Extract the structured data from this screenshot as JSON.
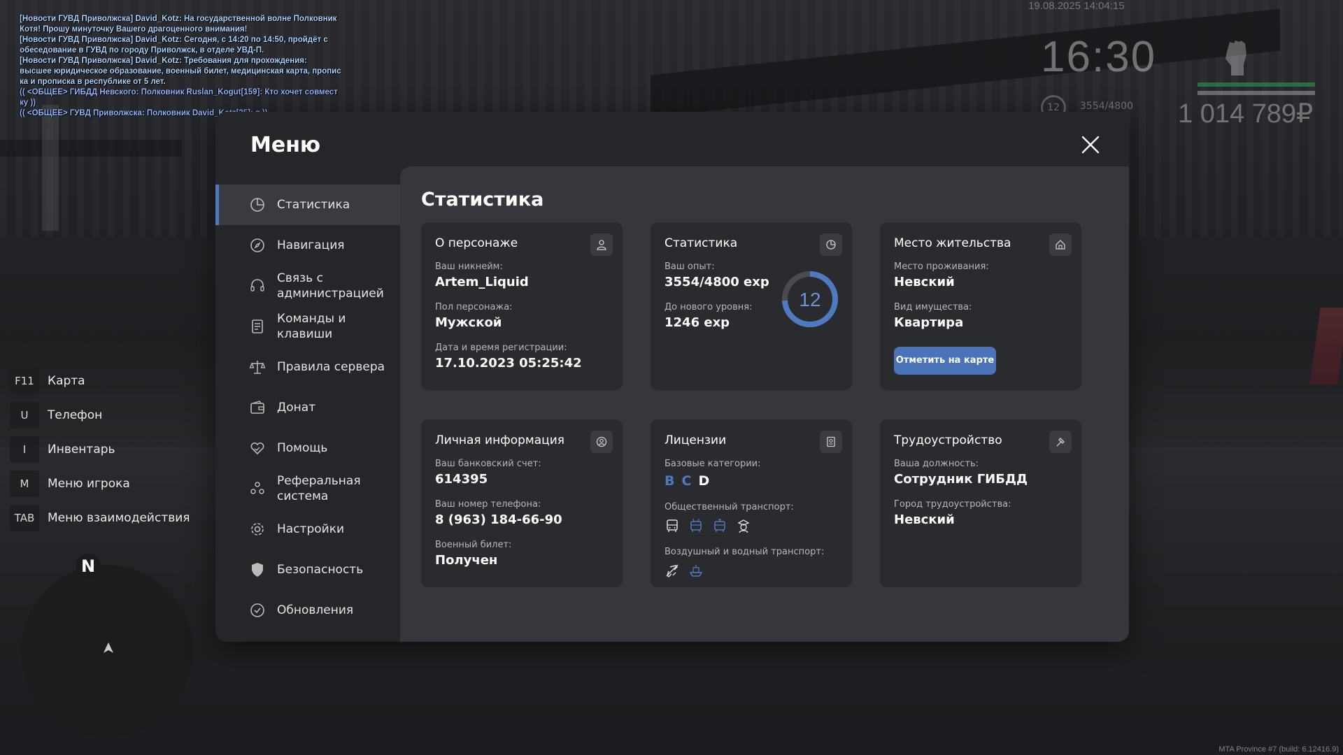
{
  "chat": [
    {
      "text": "[Новости ГУВД Приволжска] David_Kotz: На государственной волне Полковник",
      "kind": "news"
    },
    {
      "text": " Котя! Прошу минуточку Вашего драгоценного внимания!",
      "kind": "news"
    },
    {
      "text": "[Новости ГУВД Приволжска] David_Kotz: Сегодня, с 14:20 по 14:50, пройдёт с",
      "kind": "news"
    },
    {
      "text": "обеседование в ГУВД по городу Приволжск, в отделе УВД-П.",
      "kind": "news"
    },
    {
      "text": "[Новости ГУВД Приволжска] David_Kotz: Требования для прохождения:",
      "kind": "news"
    },
    {
      "text": " высшее юридическое образование, военный билет, медицинская карта, пропис",
      "kind": "news"
    },
    {
      "text": "ка и прописка в республике от 5 лет.",
      "kind": "news"
    },
    {
      "text": "(( <ОБЩЕЕ> ГИБДД Невского: Полковник Ruslan_Kogut[159]: Кто хочет совмест",
      "kind": "ooc"
    },
    {
      "text": "ку ))",
      "kind": "ooc"
    },
    {
      "text": "(( <ОБЩЕЕ> ГУВД Приволжска: Полковник David_Kotz[25]: я ))",
      "kind": "ooc"
    }
  ],
  "hud": {
    "datetime": "19.08.2025 14:04:15",
    "clock": "16:30",
    "level": "12",
    "exp": "3554/4800",
    "money": "1 014 789₽"
  },
  "hotkeys": [
    {
      "key": "F11",
      "label": "Карта"
    },
    {
      "key": "U",
      "label": "Телефон"
    },
    {
      "key": "I",
      "label": "Инвентарь"
    },
    {
      "key": "M",
      "label": "Меню игрока"
    },
    {
      "key": "TAB",
      "label": "Меню взаимодействия"
    }
  ],
  "minimap": {
    "north": "N"
  },
  "build": "MTA Province #7 (build: 6.12416.9)",
  "menu": {
    "title": "Меню",
    "nav": [
      {
        "label": "Статистика",
        "icon": "pie-chart-icon",
        "active": true
      },
      {
        "label": "Навигация",
        "icon": "compass-icon"
      },
      {
        "label": "Связь с\nадминистрацией",
        "icon": "headset-icon"
      },
      {
        "label": "Команды и\nклавиши",
        "icon": "document-icon"
      },
      {
        "label": "Правила сервера",
        "icon": "scales-icon"
      },
      {
        "label": "Донат",
        "icon": "wallet-icon"
      },
      {
        "label": "Помощь",
        "icon": "heart-hand-icon"
      },
      {
        "label": "Реферальная\nсистема",
        "icon": "people-icon"
      },
      {
        "label": "Настройки",
        "icon": "gear-icon"
      },
      {
        "label": "Безопасность",
        "icon": "shield-icon"
      },
      {
        "label": "Обновления",
        "icon": "check-circle-icon"
      }
    ]
  },
  "content": {
    "title": "Статистика",
    "character": {
      "title": "О персонаже",
      "nick_label": "Ваш никнейм:",
      "nick": "Artem_Liquid",
      "gender_label": "Пол персонажа:",
      "gender": "Мужской",
      "reg_label": "Дата и время регистрации:",
      "reg": "17.10.2023 05:25:42"
    },
    "stats": {
      "title": "Статистика",
      "exp_label": "Ваш опыт:",
      "exp": "3554/4800 exp",
      "next_label": "До нового уровня:",
      "next": "1246 exp",
      "level": "12",
      "level_progress": 0.74
    },
    "residence": {
      "title": "Место жительства",
      "place_label": "Место проживания:",
      "place": "Невский",
      "type_label": "Вид имущества:",
      "type": "Квартира",
      "button": "Отметить на карте"
    },
    "personal": {
      "title": "Личная информация",
      "bank_label": "Ваш банковский счет:",
      "bank": "614395",
      "phone_label": "Ваш номер телефона:",
      "phone": "8 (963) 184-66-90",
      "military_label": "Военный билет:",
      "military": "Получен"
    },
    "licenses": {
      "title": "Лицензии",
      "base_label": "Базовые категории:",
      "categories": [
        {
          "letter": "B",
          "color": "#4f7ac0"
        },
        {
          "letter": "C",
          "color": "#4f7ac0"
        },
        {
          "letter": "D",
          "color": "#ffffff"
        }
      ],
      "public_label": "Общественный транспорт:",
      "air_label": "Воздушный и водный транспорт:"
    },
    "job": {
      "title": "Трудоустройство",
      "position_label": "Ваша должность:",
      "position": "Сотрудник ГИБДД",
      "city_label": "Город трудоустройства:",
      "city": "Невский"
    }
  }
}
